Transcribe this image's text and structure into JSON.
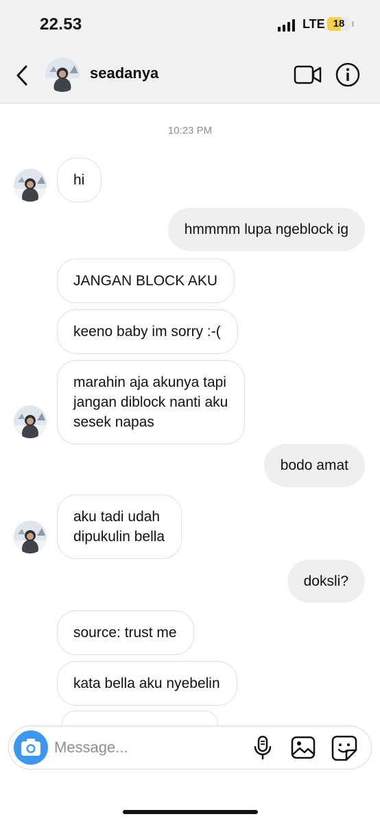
{
  "status_bar": {
    "time": "22.53",
    "network": "LTE",
    "battery": "18",
    "battery_level": 0.18
  },
  "header": {
    "username": "seadanya"
  },
  "chat": {
    "timestamp": "10:23 PM",
    "messages": [
      {
        "side": "in",
        "text": "hi"
      },
      {
        "side": "out",
        "text": "hmmmm lupa ngeblock ig"
      },
      {
        "side": "in",
        "text": "JANGAN BLOCK AKU"
      },
      {
        "side": "in",
        "text": "keeno baby im sorry :-("
      },
      {
        "side": "in",
        "text": "marahin aja akunya tapi\njangan diblock nanti aku\nsesek napas"
      },
      {
        "side": "out",
        "text": "bodo amat"
      },
      {
        "side": "in",
        "text": "aku tadi udah\ndipukulin bella"
      },
      {
        "side": "out",
        "text": "doksli?"
      },
      {
        "side": "in",
        "text": "source: trust me"
      },
      {
        "side": "in",
        "text": "kata bella aku nyebelin"
      }
    ]
  },
  "composer": {
    "placeholder": "Message..."
  },
  "colors": {
    "accent": "#3e97ee",
    "outgoing_bubble": "#efefef",
    "incoming_border": "#dedede"
  },
  "icons": [
    "back-chevron-icon",
    "video-call-icon",
    "info-icon",
    "camera-icon",
    "microphone-icon",
    "gallery-icon",
    "sticker-icon"
  ]
}
